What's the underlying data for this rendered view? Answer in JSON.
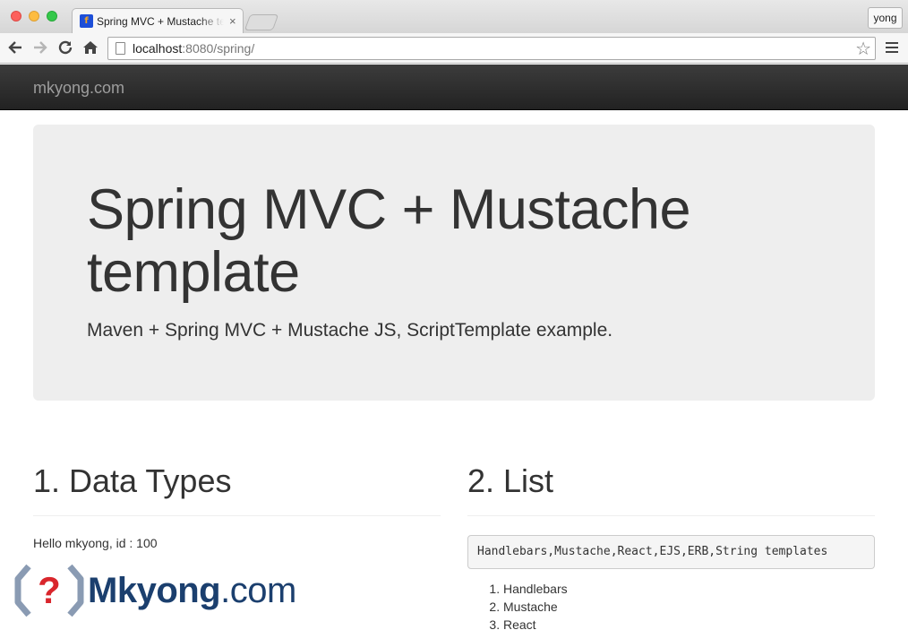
{
  "browser": {
    "tab_title": "Spring MVC + Mustache template",
    "tab_close": "×",
    "user_label": "yong",
    "url_host": "localhost",
    "url_rest": ":8080/spring/",
    "favicon_text": "f"
  },
  "navbar": {
    "brand": "mkyong.com"
  },
  "jumbotron": {
    "title": "Spring MVC + Mustache template",
    "subtitle": "Maven + Spring MVC + Mustache JS, ScriptTemplate example."
  },
  "section_data_types": {
    "heading": "1. Data Types",
    "text": "Hello mkyong, id : 100"
  },
  "section_list": {
    "heading": "2. List",
    "code": "Handlebars,Mustache,React,EJS,ERB,String templates",
    "items": [
      "Handlebars",
      "Mustache",
      "React"
    ]
  },
  "watermark": {
    "brand": "Mkyong",
    "suffix": ".com",
    "icon_symbol": "?"
  },
  "colors": {
    "navbar": "#222222",
    "jumbotron": "#eeeeee",
    "brand_text": "#9d9d9d",
    "watermark_blue": "#1b3f6e",
    "watermark_red": "#d9262c"
  }
}
